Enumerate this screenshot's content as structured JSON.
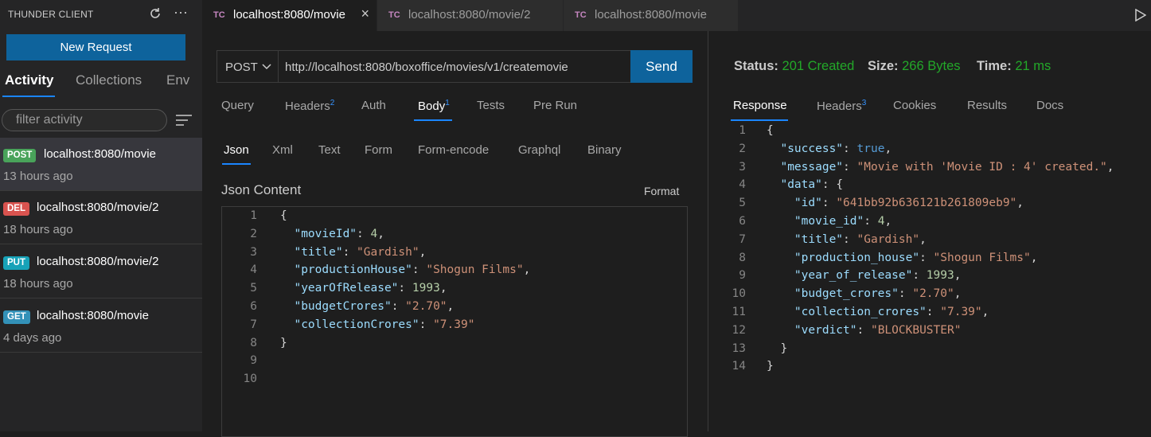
{
  "sidebar": {
    "title": "THUNDER CLIENT",
    "new_request": "New Request",
    "tabs": [
      "Activity",
      "Collections",
      "Env"
    ],
    "filter_placeholder": "filter activity",
    "history": [
      {
        "method": "POST",
        "url": "localhost:8080/movie",
        "time": "13 hours ago",
        "color": "#49a35a"
      },
      {
        "method": "DEL",
        "url": "localhost:8080/movie/2",
        "time": "18 hours ago",
        "color": "#d9534f"
      },
      {
        "method": "PUT",
        "url": "localhost:8080/movie/2",
        "time": "18 hours ago",
        "color": "#17a2b8"
      },
      {
        "method": "GET",
        "url": "localhost:8080/movie",
        "time": "4 days ago",
        "color": "#3391b8"
      }
    ]
  },
  "editor_tabs": [
    {
      "icon": "TC",
      "title": "localhost:8080/movie"
    },
    {
      "icon": "TC",
      "title": "localhost:8080/movie/2"
    },
    {
      "icon": "TC",
      "title": "localhost:8080/movie"
    }
  ],
  "request": {
    "method": "POST",
    "url": "http://localhost:8080/boxoffice/movies/v1/createmovie",
    "send": "Send",
    "tabs": {
      "query": "Query",
      "headers": "Headers",
      "headers_count": "2",
      "auth": "Auth",
      "body": "Body",
      "body_count": "1",
      "tests": "Tests",
      "pre_run": "Pre Run"
    },
    "body_types": [
      "Json",
      "Xml",
      "Text",
      "Form",
      "Form-encode",
      "Graphql",
      "Binary"
    ],
    "json_title": "Json Content",
    "format": "Format",
    "line_numbers": [
      "1",
      "2",
      "3",
      "4",
      "5",
      "6",
      "7",
      "8",
      "9",
      "10"
    ],
    "json": {
      "movieId": 4,
      "title": "Gardish",
      "productionHouse": "Shogun Films",
      "yearOfRelease": 1993,
      "budgetCrores": "2.70",
      "collectionCrores": "7.39"
    }
  },
  "response": {
    "status_label": "Status:",
    "status": "201 Created",
    "size_label": "Size:",
    "size": "266 Bytes",
    "time_label": "Time:",
    "time": "21 ms",
    "tabs": {
      "response": "Response",
      "headers": "Headers",
      "headers_count": "3",
      "cookies": "Cookies",
      "results": "Results",
      "docs": "Docs"
    },
    "line_numbers": [
      "1",
      "2",
      "3",
      "4",
      "5",
      "6",
      "7",
      "8",
      "9",
      "10",
      "11",
      "12",
      "13",
      "14"
    ],
    "json": {
      "success": true,
      "message": "Movie with 'Movie ID : 4' created.",
      "data": {
        "id": "641bb92b636121b261809eb9",
        "movie_id": 4,
        "title": "Gardish",
        "production_house": "Shogun Films",
        "year_of_release": 1993,
        "budget_crores": "2.70",
        "collection_crores": "7.39",
        "verdict": "BLOCKBUSTER"
      }
    }
  },
  "colors": {
    "accent": "#1a85ff",
    "button": "#0e639c",
    "status_ok": "#23a829",
    "tc_icon": "#c586c0"
  }
}
